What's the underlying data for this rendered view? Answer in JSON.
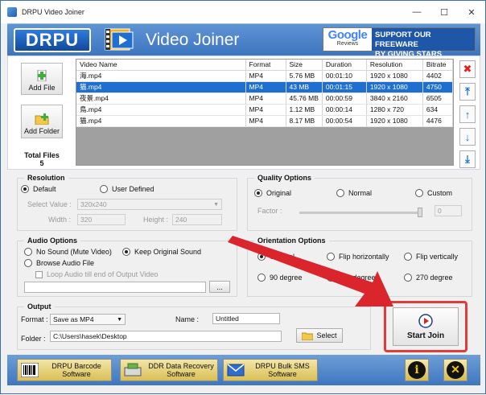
{
  "window": {
    "title": "DRPU Video Joiner",
    "controls": [
      "—",
      "☐",
      "✕"
    ]
  },
  "header": {
    "logo": "DRPU",
    "title": "Video Joiner",
    "google": {
      "word": "Google",
      "sub": "Reviews",
      "line1": "SUPPORT OUR FREEWARE",
      "line2": "BY GIVING STARS",
      "stars": "★★★★★"
    }
  },
  "files": {
    "add_file": "Add File",
    "add_folder": "Add Folder",
    "total_label": "Total Files",
    "total_value": "5",
    "columns": [
      "Video Name",
      "Format",
      "Size",
      "Duration",
      "Resolution",
      "Bitrate"
    ],
    "rows": [
      {
        "name": "海.mp4",
        "format": "MP4",
        "size": "5.76 MB",
        "duration": "00:01:10",
        "resolution": "1920 x 1080",
        "bitrate": "4402"
      },
      {
        "name": "猫.mp4",
        "format": "MP4",
        "size": "43 MB",
        "duration": "00:01:15",
        "resolution": "1920 x 1080",
        "bitrate": "4750"
      },
      {
        "name": "夜景.mp4",
        "format": "MP4",
        "size": "45.76 MB",
        "duration": "00:00:59",
        "resolution": "3840 x 2160",
        "bitrate": "6505"
      },
      {
        "name": "鳥.mp4",
        "format": "MP4",
        "size": "1.12 MB",
        "duration": "00:00:14",
        "resolution": "1280 x 720",
        "bitrate": "634"
      },
      {
        "name": "猫.mp4",
        "format": "MP4",
        "size": "8.17 MB",
        "duration": "00:00:54",
        "resolution": "1920 x 1080",
        "bitrate": "4476"
      }
    ],
    "selected_index": 1
  },
  "resolution": {
    "title": "Resolution",
    "default_label": "Default",
    "user_defined_label": "User Defined",
    "select_value_label": "Select Value :",
    "select_value": "320x240",
    "width_label": "Width :",
    "width_value": "320",
    "height_label": "Height :",
    "height_value": "240"
  },
  "quality": {
    "title": "Quality Options",
    "original": "Original",
    "normal": "Normal",
    "custom": "Custom",
    "factor_label": "Factor :",
    "factor_value": "0"
  },
  "audio": {
    "title": "Audio Options",
    "no_sound": "No Sound (Mute Video)",
    "keep_original": "Keep Original Sound",
    "browse": "Browse Audio File",
    "loop": "Loop Audio till end of Output Video",
    "browse_button": "..."
  },
  "orientation": {
    "title": "Orientation Options",
    "original": "Original",
    "flip_h": "Flip horizontally",
    "flip_v": "Flip vertically",
    "deg90": "90 degree",
    "deg180": "180 degree",
    "deg270": "270 degree"
  },
  "output": {
    "title": "Output",
    "format_label": "Format :",
    "format_value": "Save as MP4",
    "name_label": "Name :",
    "name_value": "Untitled",
    "folder_label": "Folder :",
    "folder_value": "C:\\Users\\hasek\\Desktop",
    "select_button": "Select"
  },
  "start_join": "Start Join",
  "bottom": {
    "barcode": [
      "DRPU Barcode",
      "Software"
    ],
    "recovery": [
      "DDR Data Recovery",
      "Software"
    ],
    "sms": [
      "DRPU Bulk SMS",
      "Software"
    ],
    "info_glyph": "i",
    "close_glyph": "✕"
  },
  "colors": {
    "accent": "#3d75c0",
    "selection": "#1f6fd0",
    "highlight": "#e23b3b"
  }
}
